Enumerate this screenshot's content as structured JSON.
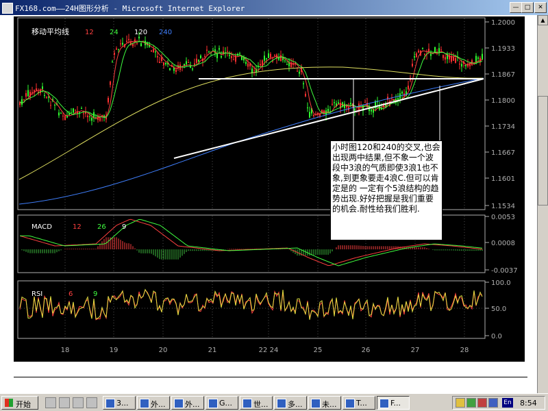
{
  "window": {
    "title": "FX168.com——24H图形分析 - Microsoft Internet Explorer",
    "buttons": {
      "minimize": "0",
      "maximize": "1",
      "close": "r"
    }
  },
  "chart": {
    "price_panel": {
      "title": "移动平均线",
      "ma_labels": [
        {
          "text": "12",
          "color": "#ff4040"
        },
        {
          "text": "24",
          "color": "#40ff40"
        },
        {
          "text": "120",
          "color": "#ffffff"
        },
        {
          "text": "240",
          "color": "#4080ff"
        }
      ],
      "y_labels": [
        "1.2000",
        "1.1933",
        "1.1867",
        "1.1800",
        "1.1734",
        "1.1667",
        "1.1601",
        "1.1534"
      ]
    },
    "macd_panel": {
      "title": "MACD",
      "labels": [
        {
          "text": "12",
          "color": "#ff4040"
        },
        {
          "text": "26",
          "color": "#40ff40"
        },
        {
          "text": "9",
          "color": "#ffffff"
        }
      ],
      "y_labels": [
        "0.0053",
        "0.0008",
        "-0.0037"
      ]
    },
    "rsi_panel": {
      "title": "RSI",
      "labels": [
        {
          "text": "6",
          "color": "#ff4040"
        },
        {
          "text": "9",
          "color": "#40ff40"
        }
      ],
      "y_labels": [
        "100.0",
        "50.0",
        "0.0"
      ]
    },
    "x_labels": [
      "18",
      "19",
      "20",
      "21",
      "22 24",
      "25",
      "26",
      "27",
      "28"
    ],
    "annotation": "小时图120和240的交叉,也会出现两中结果,但不象一个波段中3浪的气质即使3浪1也不象,到更象要走4浪C.但可以肯定是的 一定有个5浪结构的趋势出现.好好把握是我们重要的机会.耐性给我们胜利."
  },
  "taskbar": {
    "start_label": "开始",
    "buttons": [
      "3...",
      "外...",
      "外...",
      "G...",
      "世...",
      "多...",
      "未...",
      "T...",
      "F..."
    ],
    "clock": "8:54",
    "ime": "En"
  }
}
